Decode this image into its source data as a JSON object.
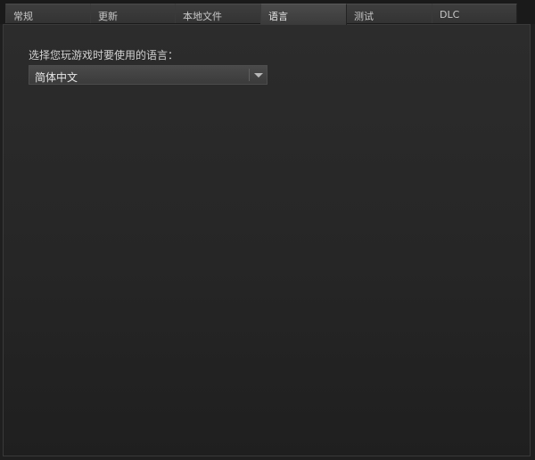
{
  "tabs": [
    {
      "label": "常规"
    },
    {
      "label": "更新"
    },
    {
      "label": "本地文件"
    },
    {
      "label": "语言"
    },
    {
      "label": "测试"
    },
    {
      "label": "DLC"
    }
  ],
  "active_tab": "语言",
  "language_panel": {
    "prompt": "选择您玩游戏时要使用的语言：",
    "selected_language": "简体中文"
  },
  "colors": {
    "background": "#1f1f1f",
    "tab": "#3a3a3a",
    "tab_active": "#484848",
    "text": "#d2d2d2"
  }
}
